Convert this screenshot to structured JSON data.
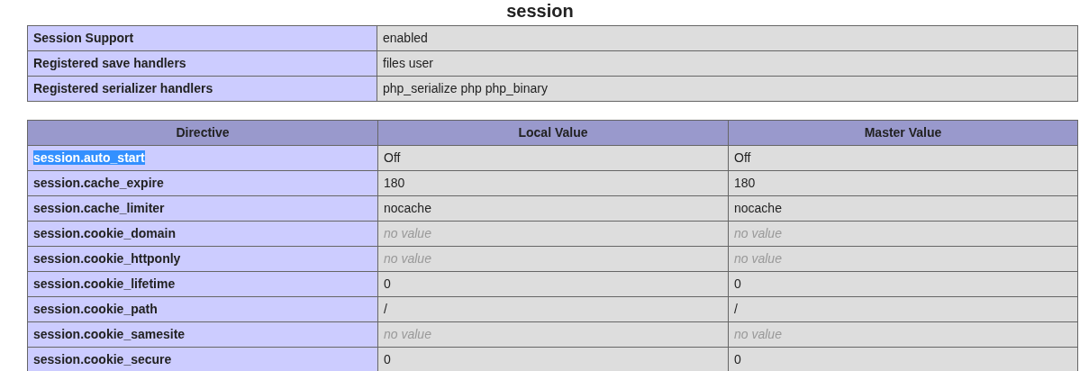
{
  "heading": "session",
  "summary": [
    {
      "label": "Session Support",
      "value": "enabled"
    },
    {
      "label": "Registered save handlers",
      "value": "files user"
    },
    {
      "label": "Registered serializer handlers",
      "value": "php_serialize php php_binary"
    }
  ],
  "directives": {
    "columns": [
      "Directive",
      "Local Value",
      "Master Value"
    ],
    "rows": [
      {
        "directive": "session.auto_start",
        "selected": true,
        "local": "Off",
        "local_missing": false,
        "master": "Off",
        "master_missing": false
      },
      {
        "directive": "session.cache_expire",
        "selected": false,
        "local": "180",
        "local_missing": false,
        "master": "180",
        "master_missing": false
      },
      {
        "directive": "session.cache_limiter",
        "selected": false,
        "local": "nocache",
        "local_missing": false,
        "master": "nocache",
        "master_missing": false
      },
      {
        "directive": "session.cookie_domain",
        "selected": false,
        "local": "no value",
        "local_missing": true,
        "master": "no value",
        "master_missing": true
      },
      {
        "directive": "session.cookie_httponly",
        "selected": false,
        "local": "no value",
        "local_missing": true,
        "master": "no value",
        "master_missing": true
      },
      {
        "directive": "session.cookie_lifetime",
        "selected": false,
        "local": "0",
        "local_missing": false,
        "master": "0",
        "master_missing": false
      },
      {
        "directive": "session.cookie_path",
        "selected": false,
        "local": "/",
        "local_missing": false,
        "master": "/",
        "master_missing": false
      },
      {
        "directive": "session.cookie_samesite",
        "selected": false,
        "local": "no value",
        "local_missing": true,
        "master": "no value",
        "master_missing": true
      },
      {
        "directive": "session.cookie_secure",
        "selected": false,
        "local": "0",
        "local_missing": false,
        "master": "0",
        "master_missing": false
      }
    ]
  }
}
